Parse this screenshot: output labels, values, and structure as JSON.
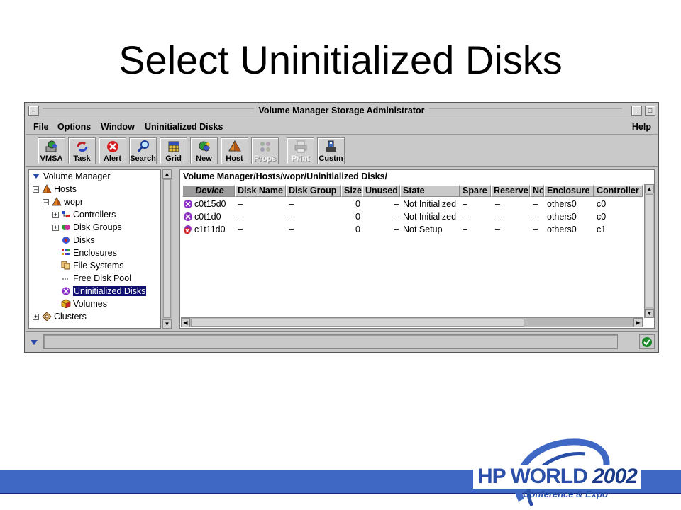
{
  "slide": {
    "title": "Select Uninitialized Disks"
  },
  "window": {
    "title": "Volume Manager Storage Administrator"
  },
  "menu": {
    "file": "File",
    "options": "Options",
    "window": "Window",
    "uninit": "Uninitialized Disks",
    "help": "Help"
  },
  "toolbar": [
    {
      "label": "VMSA",
      "icon": "vmsa-icon",
      "disabled": false
    },
    {
      "label": "Task",
      "icon": "task-icon",
      "disabled": false
    },
    {
      "label": "Alert",
      "icon": "alert-icon",
      "disabled": false
    },
    {
      "label": "Search",
      "icon": "search-icon",
      "disabled": false
    },
    {
      "label": "Grid",
      "icon": "grid-icon",
      "disabled": false
    },
    {
      "label": "New",
      "icon": "new-icon",
      "disabled": false
    },
    {
      "label": "Host",
      "icon": "host-icon",
      "disabled": false
    },
    {
      "label": "Props",
      "icon": "props-icon",
      "disabled": true
    },
    {
      "label": "Print",
      "icon": "print-icon",
      "disabled": true
    },
    {
      "label": "Custm",
      "icon": "customize-icon",
      "disabled": false
    }
  ],
  "tree": {
    "root": "Volume Manager",
    "hosts": "Hosts",
    "host": "wopr",
    "controllers": "Controllers",
    "disk_groups": "Disk Groups",
    "disks": "Disks",
    "enclosures": "Enclosures",
    "file_systems": "File Systems",
    "free_disk_pool": "Free Disk Pool",
    "uninitialized_disks": "Uninitialized Disks",
    "volumes": "Volumes",
    "clusters": "Clusters"
  },
  "content": {
    "path": "Volume Manager/Hosts/wopr/Uninitialized Disks/",
    "columns": [
      "Device",
      "Disk Name",
      "Disk Group",
      "Size",
      "Unused",
      "State",
      "Spare",
      "Reserve",
      "No",
      "Enclosure",
      "Controller"
    ],
    "rows": [
      [
        "c0t15d0",
        "–",
        "–",
        "0",
        "–",
        "Not Initialized",
        "–",
        "–",
        "–",
        "others0",
        "c0"
      ],
      [
        "c0t1d0",
        "–",
        "–",
        "0",
        "–",
        "Not Initialized",
        "–",
        "–",
        "–",
        "others0",
        "c0"
      ],
      [
        "c1t11d0",
        "–",
        "–",
        "0",
        "–",
        "Not Setup",
        "–",
        "–",
        "–",
        "others0",
        "c1"
      ]
    ],
    "row_icons": [
      "uninitialized-disk-icon",
      "uninitialized-disk-icon",
      "error-disk-icon"
    ]
  },
  "logo": {
    "brand": "HP WORLD",
    "year": "2002",
    "tagline": "Conference & Expo"
  },
  "colors": {
    "selection": "#10106e",
    "footer_band": "#3e68c4",
    "logo_blue": "#2a4fa8"
  }
}
